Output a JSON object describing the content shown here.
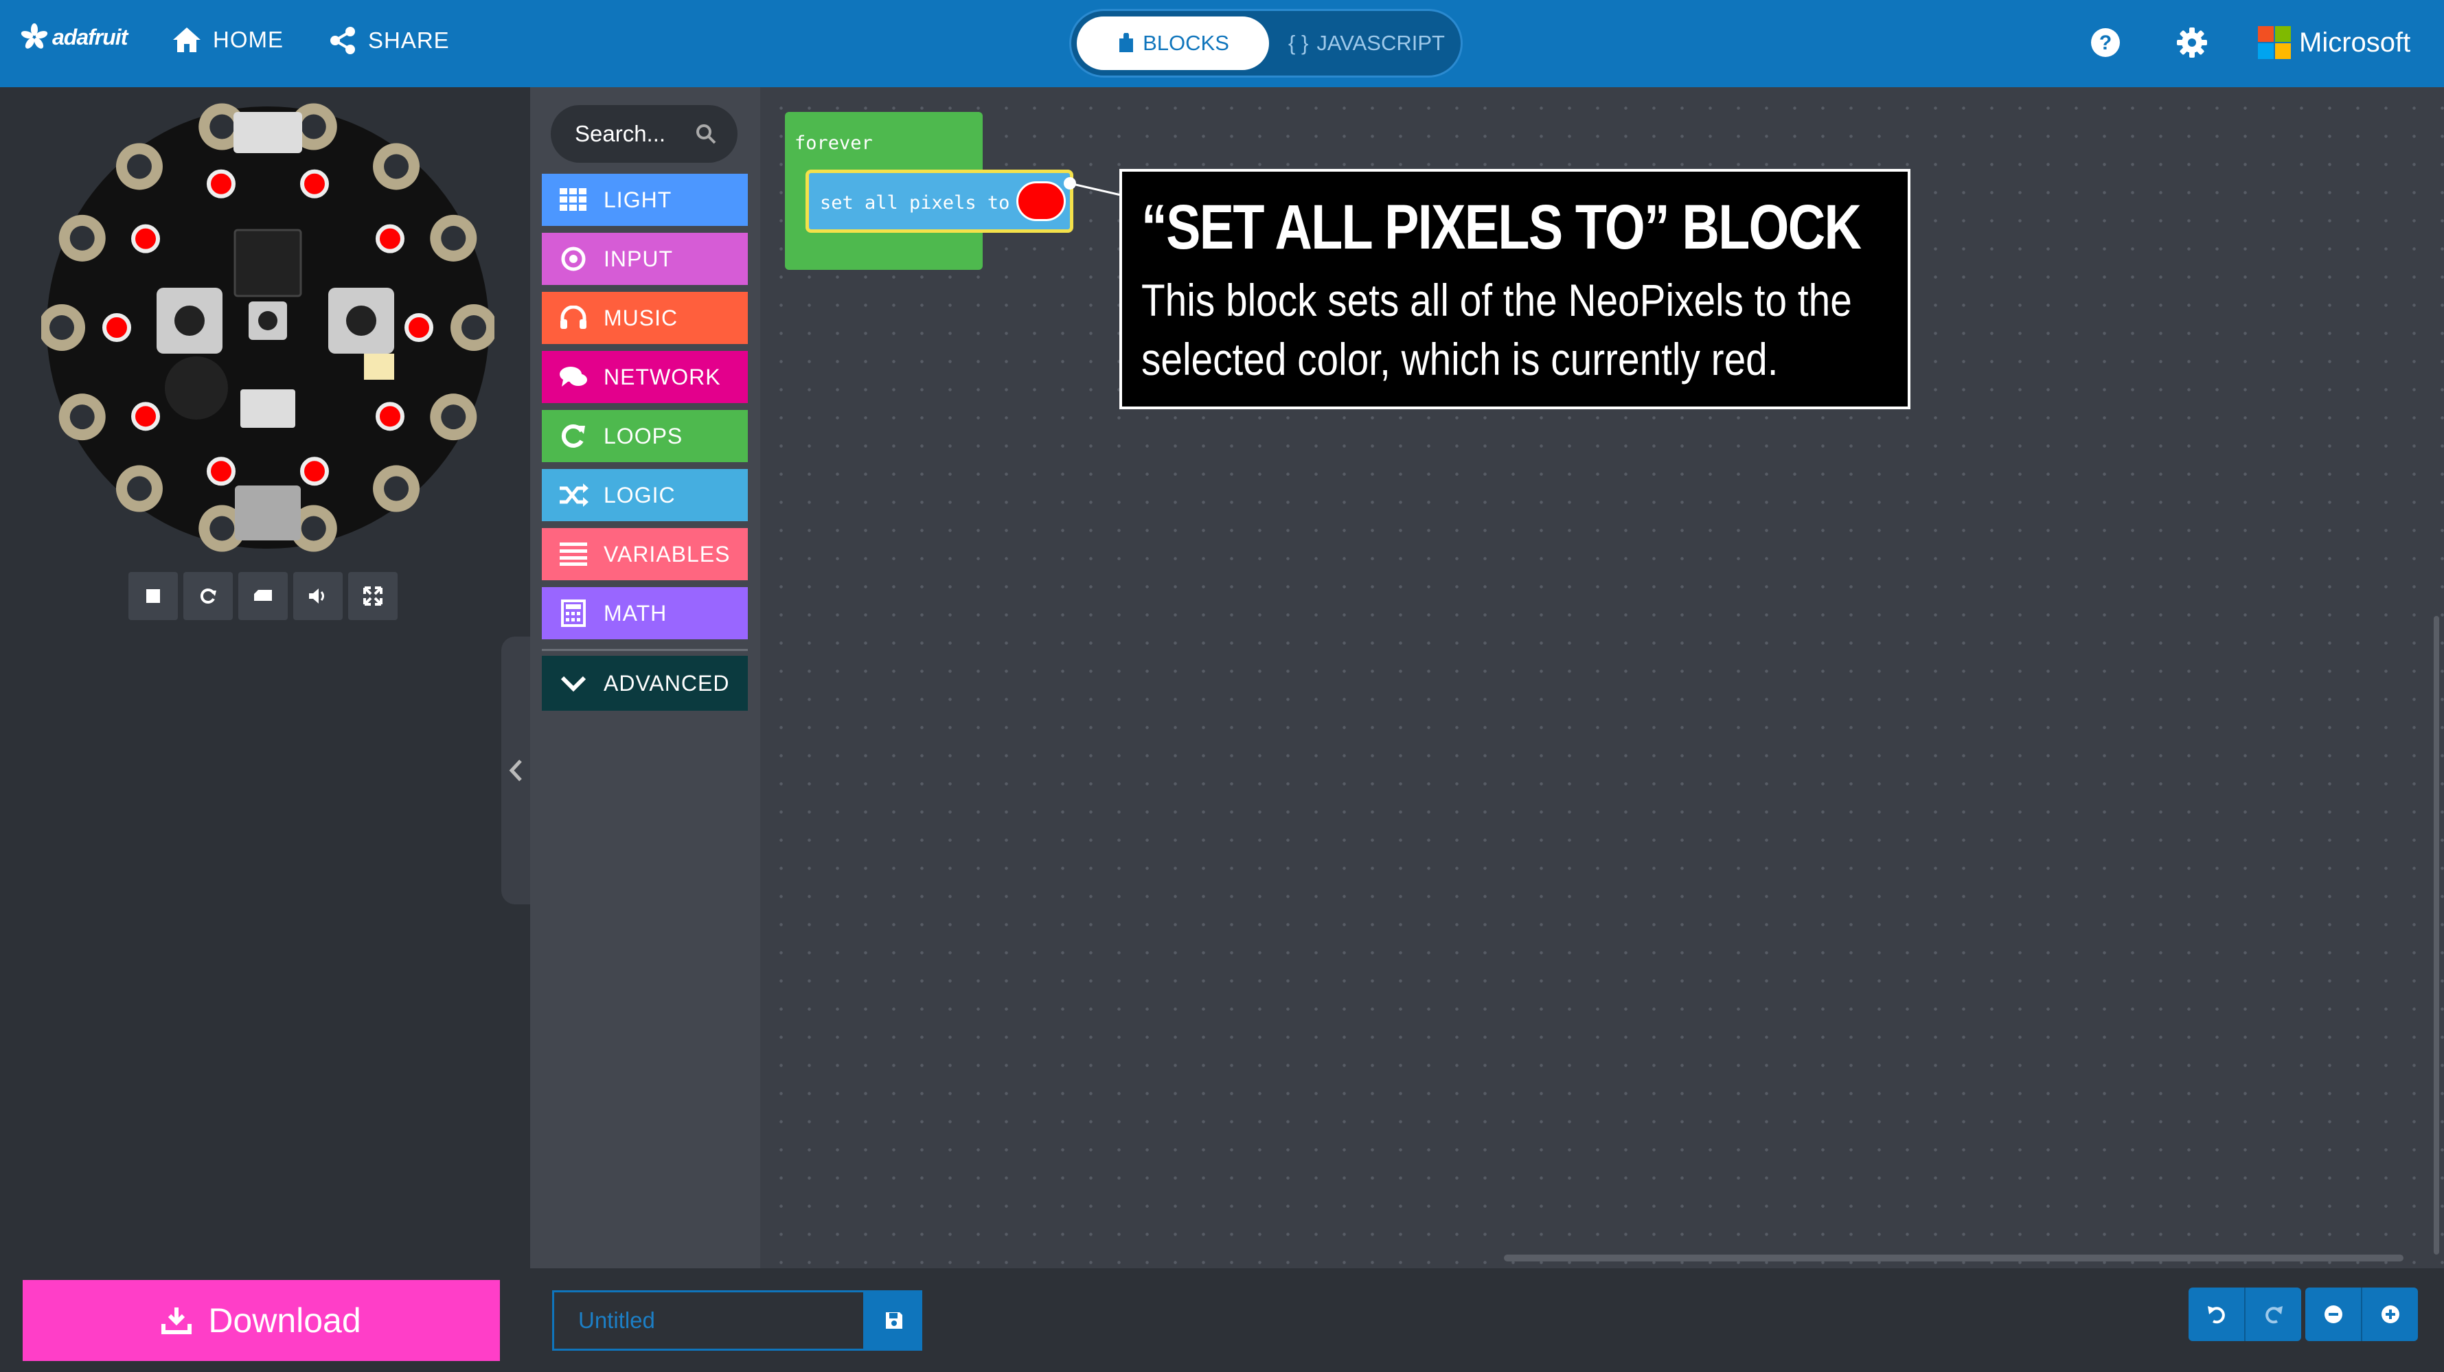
{
  "topbar": {
    "logo_text": "adafruit",
    "home_label": "HOME",
    "share_label": "SHARE",
    "blocks_label": "BLOCKS",
    "javascript_label": "JAVASCRIPT",
    "javascript_icon": "{ }",
    "brand": "Microsoft"
  },
  "simulator": {
    "controls": [
      "stop-icon",
      "restart-icon",
      "screenshot-icon",
      "sound-icon",
      "fullscreen-icon"
    ]
  },
  "toolbox": {
    "search_placeholder": "Search...",
    "categories": [
      {
        "label": "LIGHT",
        "color": "#4c97ff",
        "icon": "grid-icon"
      },
      {
        "label": "INPUT",
        "color": "#d65cd6",
        "icon": "target-icon"
      },
      {
        "label": "MUSIC",
        "color": "#ff5f3d",
        "icon": "headphones-icon"
      },
      {
        "label": "NETWORK",
        "color": "#e3008c",
        "icon": "chat-icon"
      },
      {
        "label": "LOOPS",
        "color": "#4eb94e",
        "icon": "refresh-icon"
      },
      {
        "label": "LOGIC",
        "color": "#45aee0",
        "icon": "shuffle-icon"
      },
      {
        "label": "VARIABLES",
        "color": "#ff6680",
        "icon": "list-icon"
      },
      {
        "label": "MATH",
        "color": "#9966ff",
        "icon": "calculator-icon"
      }
    ],
    "advanced_label": "ADVANCED",
    "advanced_color": "#0b3a3f"
  },
  "workspace": {
    "forever_label": "forever",
    "set_pixels_label": "set all pixels to",
    "pixel_color": "#ff0000",
    "callout_title": "“SET ALL PIXELS TO” BLOCK",
    "callout_body": "This block sets all of the NeoPixels to the selected color, which is currently red."
  },
  "bottombar": {
    "download_label": "Download",
    "project_name_placeholder": "Untitled"
  }
}
